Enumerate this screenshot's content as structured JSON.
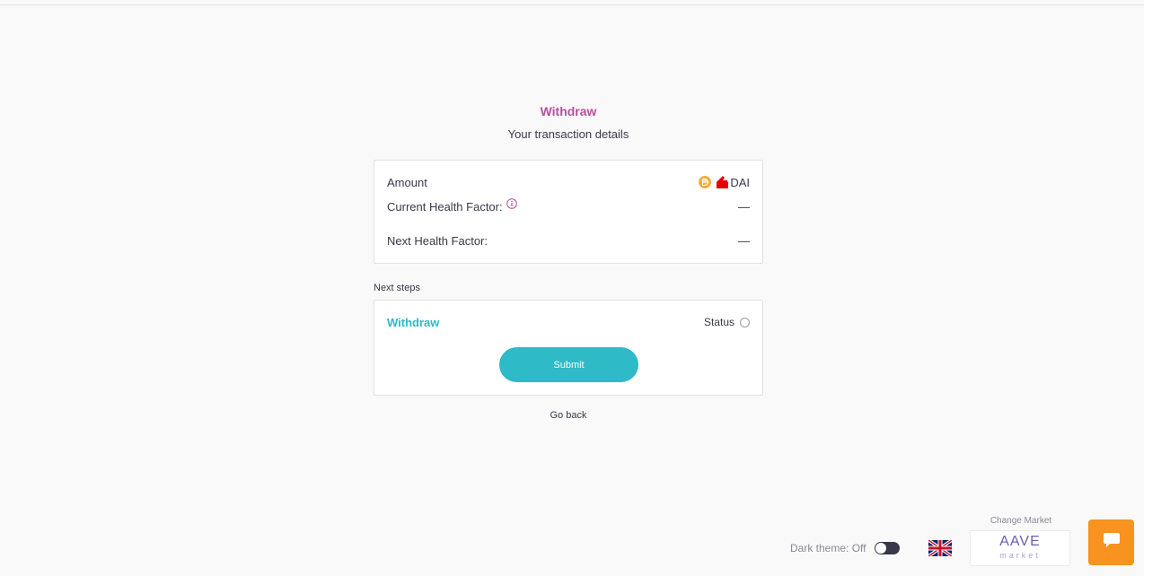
{
  "header": {
    "title": "Withdraw",
    "subtitle": "Your transaction details"
  },
  "details": {
    "amount_label": "Amount",
    "amount_currency": "DAI",
    "current_health_label": "Current Health Factor:",
    "current_health_value": "—",
    "next_health_label": "Next Health Factor:",
    "next_health_value": "—"
  },
  "steps": {
    "section_label": "Next steps",
    "step_title": "Withdraw",
    "status_label": "Status",
    "submit_label": "Submit",
    "go_back_label": "Go back"
  },
  "footer": {
    "dark_theme_label": "Dark theme: Off",
    "language_icon": "uk-flag-icon",
    "change_market_label": "Change Market",
    "market_brand": "AAVE",
    "market_sub": "market",
    "chat_icon": "chat-bubble-icon"
  },
  "colors": {
    "title_accent": "#b6509e",
    "primary_teal": "#2ebac6",
    "chat_orange": "#f7931e",
    "coin_yellow": "#f5ac37",
    "background": "#f9f9f9"
  }
}
